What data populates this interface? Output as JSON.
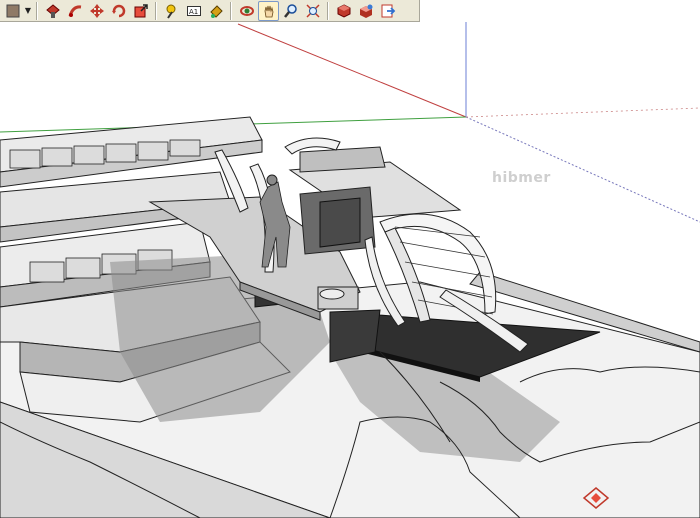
{
  "toolbar": {
    "tools": [
      {
        "name": "paint-bucket-tool",
        "icon": "paint-bucket-icon"
      },
      {
        "name": "push-pull-tool",
        "icon": "push-pull-icon"
      },
      {
        "name": "follow-me-tool",
        "icon": "follow-me-icon"
      },
      {
        "name": "move-tool",
        "icon": "move-icon"
      },
      {
        "name": "rotate-tool",
        "icon": "rotate-icon"
      },
      {
        "name": "scale-tool",
        "icon": "scale-icon"
      },
      {
        "name": "tape-measure-tool",
        "icon": "tape-measure-icon"
      },
      {
        "name": "text-tool",
        "icon": "text-icon",
        "label": "A1"
      },
      {
        "name": "paint-tool",
        "icon": "paint-icon"
      },
      {
        "name": "orbit-tool",
        "icon": "orbit-icon"
      },
      {
        "name": "pan-tool",
        "icon": "pan-hand-icon",
        "active": true
      },
      {
        "name": "zoom-tool",
        "icon": "zoom-icon"
      },
      {
        "name": "zoom-extents-tool",
        "icon": "zoom-extents-icon"
      },
      {
        "name": "get-models-tool",
        "icon": "get-models-icon"
      },
      {
        "name": "share-model-tool",
        "icon": "share-model-icon"
      },
      {
        "name": "export-tool",
        "icon": "export-icon"
      }
    ]
  },
  "watermark": {
    "text": "hibmer"
  },
  "colors": {
    "toolbar_bg": "#ece9d8",
    "axis_red": "#c04040",
    "axis_green": "#40a040",
    "axis_blue": "#6b7fd6",
    "model_dark": "#333333",
    "model_mid": "#8a8a8a",
    "model_light": "#e6e6e6"
  }
}
